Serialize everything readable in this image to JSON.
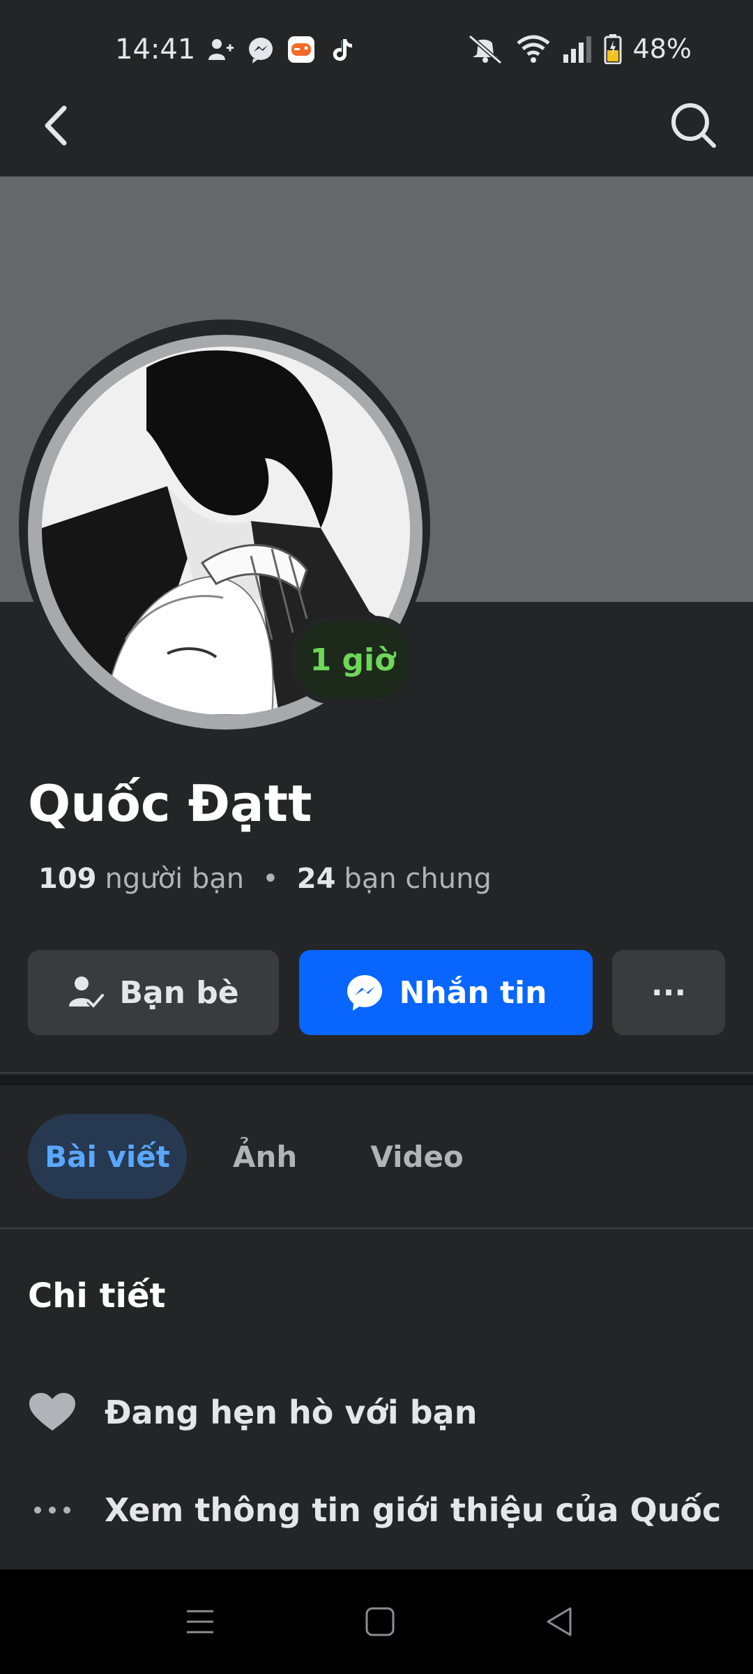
{
  "status_bar": {
    "time": "14:41",
    "battery": "48%",
    "notification_icons": [
      "add-friend-icon",
      "messenger-icon",
      "game-app-icon",
      "tiktok-icon"
    ],
    "system_icons": [
      "mute-icon",
      "wifi-icon",
      "signal-icon",
      "battery-icon"
    ]
  },
  "profile": {
    "name": "Quốc Đạtt",
    "active_status": "1 giờ",
    "friends_count": "109",
    "friends_label": "người bạn",
    "separator": "•",
    "mutual_count": "24",
    "mutual_label": "bạn chung"
  },
  "actions": {
    "friends_label": "Bạn bè",
    "message_label": "Nhắn tin",
    "more_label": "···"
  },
  "tabs": [
    {
      "label": "Bài viết",
      "active": true
    },
    {
      "label": "Ảnh",
      "active": false
    },
    {
      "label": "Video",
      "active": false
    }
  ],
  "details": {
    "title": "Chi tiết",
    "items": [
      {
        "icon": "heart-icon",
        "text": "Đang hẹn hò với bạn"
      },
      {
        "icon": "ellipsis-icon",
        "text": "Xem thông tin giới thiệu của Quốc"
      }
    ]
  },
  "colors": {
    "background": "#242526",
    "cover": "#65676b",
    "primary_button": "#0866ff",
    "active_tab_bg": "#263951",
    "active_tab_text": "#5aa7ff",
    "online_green": "#6fd65a"
  }
}
